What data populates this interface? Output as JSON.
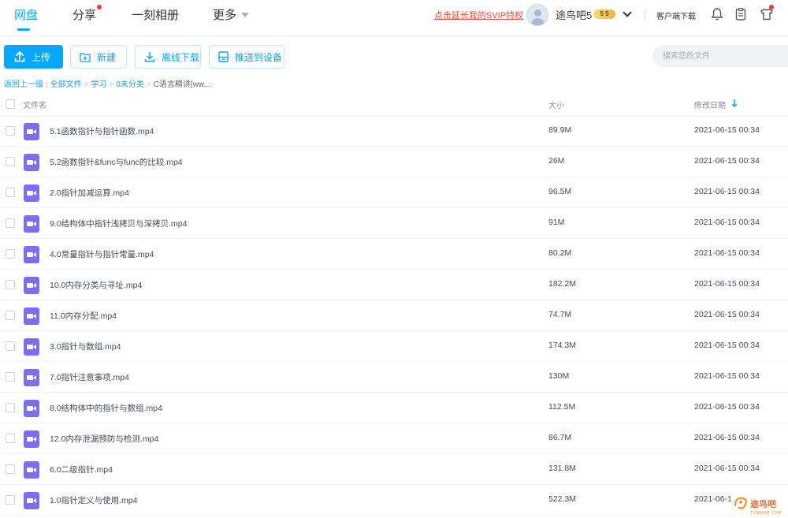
{
  "nav": {
    "tabs": [
      {
        "label": "网盘"
      },
      {
        "label": "分享"
      },
      {
        "label": "一刻相册"
      },
      {
        "label": "更多"
      }
    ],
    "svip_link": "点击延长我的SVIP特权",
    "username": "途鸟吧5",
    "vip_level": "5 5",
    "client_download": "客户端下载"
  },
  "toolbar": {
    "upload": "上传",
    "new": "新建",
    "offline_download": "离线下载",
    "push_to_device": "推送到设备",
    "search_placeholder": "搜索您的文件"
  },
  "breadcrumb": {
    "back": "返回上一级",
    "all_files": "全部文件",
    "study": "学习",
    "uncategorized": "0未分类",
    "current": "C语言精讲[ww..."
  },
  "table": {
    "headers": {
      "name": "文件名",
      "size": "大小",
      "modified": "修改日期"
    },
    "rows": [
      {
        "name": "5.1函数指针与指针函数.mp4",
        "size": "89.9M",
        "date": "2021-06-15 00:34"
      },
      {
        "name": "5.2函数指针&func与func的比较.mp4",
        "size": "26M",
        "date": "2021-06-15 00:34"
      },
      {
        "name": "2.0指针加减运算.mp4",
        "size": "96.5M",
        "date": "2021-06-15 00:34"
      },
      {
        "name": "9.0结构体中指针浅拷贝与深拷贝.mp4",
        "size": "91M",
        "date": "2021-06-15 00:34"
      },
      {
        "name": "4.0常量指针与指针常量.mp4",
        "size": "80.2M",
        "date": "2021-06-15 00:34"
      },
      {
        "name": "10.0内存分类与寻址.mp4",
        "size": "182.2M",
        "date": "2021-06-15 00:34"
      },
      {
        "name": "11.0内存分配.mp4",
        "size": "74.7M",
        "date": "2021-06-15 00:34"
      },
      {
        "name": "3.0指针与数组.mp4",
        "size": "174.3M",
        "date": "2021-06-15 00:34"
      },
      {
        "name": "7.0指针注意事项.mp4",
        "size": "130M",
        "date": "2021-06-15 00:34"
      },
      {
        "name": "8.0结构体中的指针与数组.mp4",
        "size": "112.5M",
        "date": "2021-06-15 00:34"
      },
      {
        "name": "12.0内存泄漏预防与检测.mp4",
        "size": "86.7M",
        "date": "2021-06-15 00:34"
      },
      {
        "name": "6.0二级指针.mp4",
        "size": "131.8M",
        "date": "2021-06-15 00:34"
      },
      {
        "name": "1.0指针定义与使用.mp4",
        "size": "522.3M",
        "date": "2021-06-1"
      }
    ]
  },
  "watermark": {
    "text": "途鸟吧",
    "sub": "TUNIAO8.COM"
  },
  "colors": {
    "accent": "#06a7ff",
    "video_icon": "#7b6ff0",
    "svip": "#f24a3c"
  }
}
